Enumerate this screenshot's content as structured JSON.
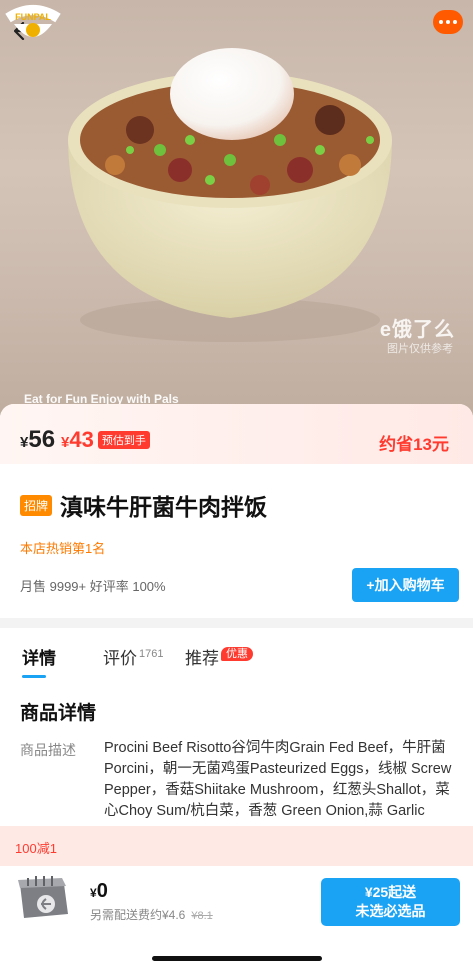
{
  "hero": {
    "watermark": "e饿了么",
    "watermark_sub": "图片仅供参考",
    "slogan": "Eat for Fun Enjoy with Pals",
    "brand_logo_text": "FUNPAL",
    "back_icon": "arrow-left-icon",
    "more_icon": "more-dots-icon"
  },
  "price": {
    "currency": "¥",
    "original": "56",
    "current": "43",
    "estimate_badge": "预估到手",
    "savings": "约省13元"
  },
  "product": {
    "badge": "招牌",
    "title": "滇味牛肝菌牛肉拌饭",
    "rank": "本店热销第1名",
    "stats": "月售 9999+ 好评率 100%",
    "add_to_cart": "+加入购物车"
  },
  "tabs": [
    {
      "label": "详情",
      "active": true
    },
    {
      "label": "评价",
      "count": "1761"
    },
    {
      "label": "推荐",
      "badge": "优惠"
    }
  ],
  "details": {
    "section_title": "商品详情",
    "desc_label": "商品描述",
    "desc_text": "Procini Beef Risotto谷饲牛肉Grain Fed Beef，牛肝菌Porcini，朝一无菌鸡蛋Pasteurized Eggs，线椒 Screw Pepper，香菇Shiitake Mushroom，红葱头Shallot，菜心Choy Sum/杭白菜，香葱 Green Onion,蒜 Garlic"
  },
  "promo": {
    "text": "100减1"
  },
  "bottom": {
    "currency": "¥",
    "total": "0",
    "delivery_text": "另需配送费约¥4.6",
    "delivery_original": "¥8.1",
    "checkout_line1": "¥25起送",
    "checkout_line2": "未选必选品",
    "cart_icon": "cart-box-icon"
  },
  "colors": {
    "accent_blue": "#1aa3f5",
    "price_red": "#ff3b30",
    "orange": "#ff7a00"
  }
}
